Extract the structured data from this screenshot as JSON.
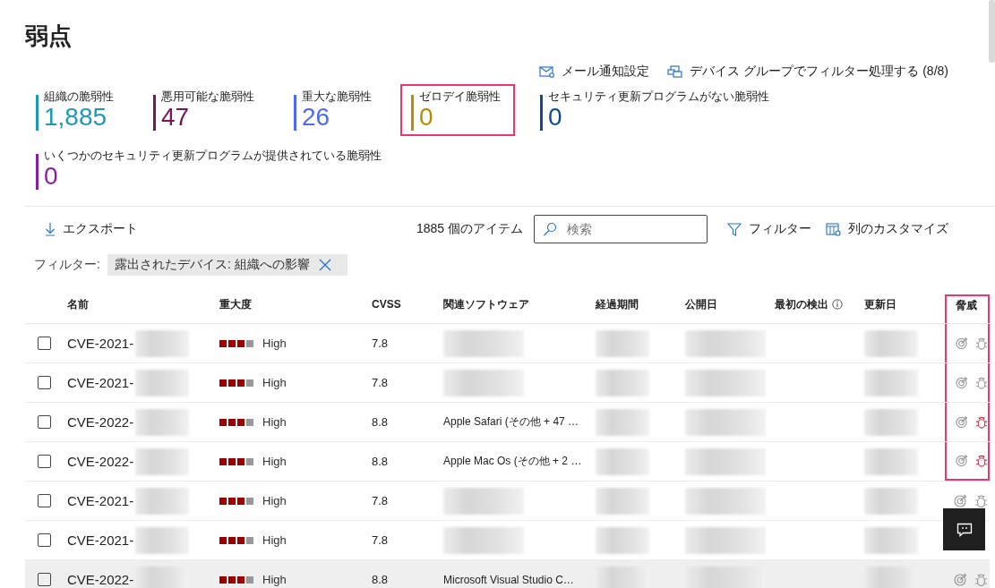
{
  "page_title": "弱点",
  "actions": [
    {
      "kind": "mail",
      "label": "メール通知設定"
    },
    {
      "kind": "devices",
      "label": "デバイス グループでフィルター処理する (8/8)"
    }
  ],
  "metrics": [
    {
      "label": "組織の脆弱性",
      "value": "1,885",
      "color": "#1f98b8",
      "highlighted": false
    },
    {
      "label": "悪用可能な脆弱性",
      "value": "47",
      "color": "#7a1556",
      "highlighted": false
    },
    {
      "label": "重大な脆弱性",
      "value": "26",
      "color": "#4f6bed",
      "highlighted": false
    },
    {
      "label": "ゼロデイ脆弱性",
      "value": "0",
      "color": "#b38f00",
      "highlighted": true
    },
    {
      "label": "セキュリティ更新プログラムがない脆弱性",
      "value": "0",
      "color": "#0e4a8c",
      "highlighted": false
    },
    {
      "label": "いくつかのセキュリティ更新プログラムが提供されている脆弱性",
      "value": "0",
      "color": "#8a1fa2",
      "highlighted": false
    }
  ],
  "toolbar": {
    "export": "エクスポート",
    "item_count": "1885 個のアイテム",
    "search": {
      "placeholder": "検索"
    },
    "filter": "フィルター",
    "customize": "列のカスタマイズ"
  },
  "filter_bar": {
    "label": "フィルター:",
    "chips": [
      {
        "text": "露出されたデバイス: 組織への影響"
      }
    ]
  },
  "table": {
    "columns": [
      {
        "label": "名前",
        "highlighted": false
      },
      {
        "label": "重大度",
        "highlighted": false
      },
      {
        "label": "CVSS",
        "highlighted": false
      },
      {
        "label": "関連ソフトウェア",
        "highlighted": false
      },
      {
        "label": "経過期間",
        "highlighted": false
      },
      {
        "label": "公開日",
        "highlighted": false
      },
      {
        "label": "最初の検出",
        "info": true,
        "highlighted": false
      },
      {
        "label": "更新日",
        "highlighted": false
      },
      {
        "label": "脅威",
        "highlighted": true
      }
    ],
    "rows": [
      {
        "checked": false,
        "selected": false,
        "name": "CVE-2021-",
        "severity": "High",
        "level": 0.75,
        "cvss": "7.8",
        "bug_active": false,
        "highlighted": true
      },
      {
        "checked": false,
        "selected": false,
        "name": "CVE-2021-",
        "severity": "High",
        "level": 0.75,
        "cvss": "7.8",
        "bug_active": false,
        "highlighted": true
      },
      {
        "checked": false,
        "selected": false,
        "name": "CVE-2022-",
        "severity": "High",
        "level": 0.75,
        "cvss": "8.8",
        "software": "Apple Safari (その他 + 47 …",
        "bug_active": true,
        "highlighted": true
      },
      {
        "checked": false,
        "selected": false,
        "name": "CVE-2022-",
        "severity": "High",
        "level": 0.75,
        "cvss": "8.8",
        "software": "Apple Mac Os (その他 + 2 …",
        "bug_active": true,
        "highlighted": true
      },
      {
        "checked": false,
        "selected": false,
        "name": "CVE-2021-",
        "severity": "High",
        "level": 0.75,
        "cvss": "7.8",
        "bug_active": false,
        "highlighted": false
      },
      {
        "checked": false,
        "selected": false,
        "name": "CVE-2021-",
        "severity": "High",
        "level": 0.75,
        "cvss": "7.8",
        "highlighted": false
      },
      {
        "checked": false,
        "selected": true,
        "name": "CVE-2022-",
        "severity": "High",
        "level": 0.75,
        "cvss": "8.8",
        "software": "Microsoft Visual Studio C…",
        "bug_active": false,
        "highlighted": false
      }
    ]
  }
}
